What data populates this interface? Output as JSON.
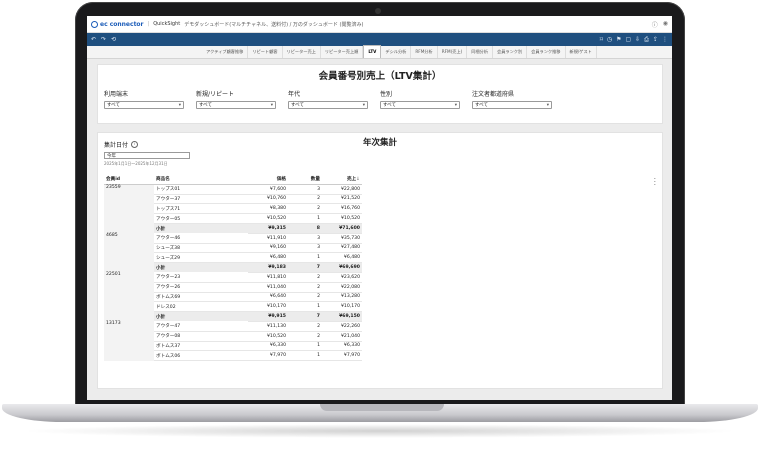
{
  "header": {
    "logo": "ec connector",
    "product": "QuickSight",
    "breadcrumb": "デモダッシュボード(マルチチャネル、送料付) / 万のダッシュボード (閲覧済み)"
  },
  "tabs": [
    {
      "label": "アクティブ顧客推移",
      "active": false
    },
    {
      "label": "リピート顧客",
      "active": false
    },
    {
      "label": "リピーター売上",
      "active": false
    },
    {
      "label": "リピーター売上順",
      "active": false
    },
    {
      "label": "LTV",
      "active": true
    },
    {
      "label": "デシル分析",
      "active": false
    },
    {
      "label": "RFM分析",
      "active": false
    },
    {
      "label": "RFM(売上)",
      "active": false
    },
    {
      "label": "同梱分析",
      "active": false
    },
    {
      "label": "会員ランク別",
      "active": false
    },
    {
      "label": "会員ランク推移",
      "active": false
    },
    {
      "label": "新規/ゲスト",
      "active": false
    }
  ],
  "report": {
    "title": "会員番号別売上（LTV集計）",
    "filters": [
      {
        "label": "利用端末",
        "value": "すべて"
      },
      {
        "label": "新規/リピート",
        "value": "すべて"
      },
      {
        "label": "年代",
        "value": "すべて"
      },
      {
        "label": "性別",
        "value": "すべて"
      },
      {
        "label": "注文者都道府県",
        "value": "すべて"
      }
    ]
  },
  "annual": {
    "title": "年次集計",
    "date_label": "集計日付",
    "date_value": "今年",
    "date_range": "2025年1月1日～2025年12月31日",
    "columns": [
      "会員id",
      "商品名",
      "価格",
      "数量",
      "売上"
    ],
    "groups": [
      {
        "member_id": "23559",
        "rows": [
          {
            "item": "トップス01",
            "price": "¥7,600",
            "qty": "3",
            "sales": "¥22,800"
          },
          {
            "item": "アウター37",
            "price": "¥10,760",
            "qty": "2",
            "sales": "¥21,520"
          },
          {
            "item": "トップス71",
            "price": "¥8,380",
            "qty": "2",
            "sales": "¥16,760"
          },
          {
            "item": "アウター05",
            "price": "¥10,520",
            "qty": "1",
            "sales": "¥10,520"
          }
        ],
        "subtotal": {
          "label": "小計",
          "price": "¥9,315",
          "qty": "8",
          "sales": "¥71,600"
        }
      },
      {
        "member_id": "4685",
        "rows": [
          {
            "item": "アウター46",
            "price": "¥11,910",
            "qty": "3",
            "sales": "¥35,730"
          },
          {
            "item": "シューズ38",
            "price": "¥9,160",
            "qty": "3",
            "sales": "¥27,480"
          },
          {
            "item": "シューズ29",
            "price": "¥6,480",
            "qty": "1",
            "sales": "¥6,480"
          }
        ],
        "subtotal": {
          "label": "小計",
          "price": "¥9,183",
          "qty": "7",
          "sales": "¥69,690"
        }
      },
      {
        "member_id": "22501",
        "rows": [
          {
            "item": "アウター23",
            "price": "¥11,810",
            "qty": "2",
            "sales": "¥23,620"
          },
          {
            "item": "アウター26",
            "price": "¥11,040",
            "qty": "2",
            "sales": "¥22,080"
          },
          {
            "item": "ボトムス69",
            "price": "¥6,640",
            "qty": "2",
            "sales": "¥13,280"
          },
          {
            "item": "ドレス02",
            "price": "¥10,170",
            "qty": "1",
            "sales": "¥10,170"
          }
        ],
        "subtotal": {
          "label": "小計",
          "price": "¥9,915",
          "qty": "7",
          "sales": "¥69,150"
        }
      },
      {
        "member_id": "13173",
        "rows": [
          {
            "item": "アウター47",
            "price": "¥11,130",
            "qty": "2",
            "sales": "¥22,260"
          },
          {
            "item": "アウター08",
            "price": "¥10,520",
            "qty": "2",
            "sales": "¥21,040"
          },
          {
            "item": "ボトムス37",
            "price": "¥6,330",
            "qty": "1",
            "sales": "¥6,330"
          },
          {
            "item": "ボトムス06",
            "price": "¥7,970",
            "qty": "1",
            "sales": "¥7,970"
          }
        ],
        "subtotal": null
      }
    ]
  }
}
